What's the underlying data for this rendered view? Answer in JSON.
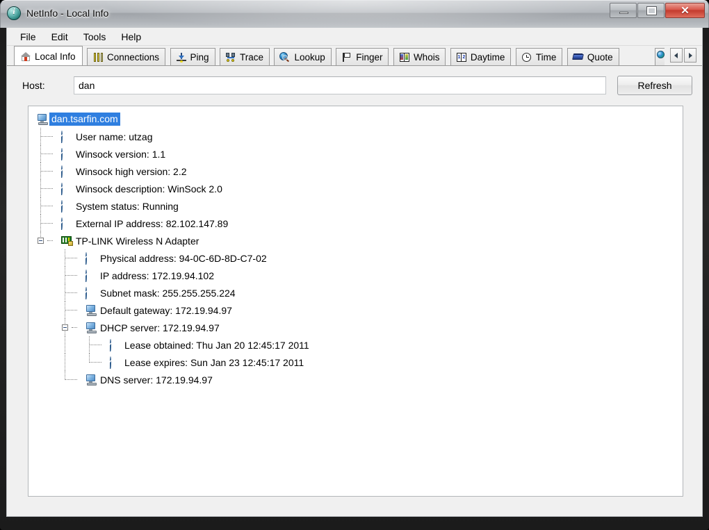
{
  "window": {
    "title": "NetInfo - Local Info",
    "app_icon": "info-circle-icon",
    "minimize_label": "Minimize",
    "maximize_label": "Maximize",
    "close_label": "✕"
  },
  "menubar": {
    "items": [
      {
        "label": "File"
      },
      {
        "label": "Edit"
      },
      {
        "label": "Tools"
      },
      {
        "label": "Help"
      }
    ]
  },
  "tabs": {
    "items": [
      {
        "label": "Local Info",
        "icon": "home-icon",
        "active": true
      },
      {
        "label": "Connections",
        "icon": "connections-icon",
        "active": false
      },
      {
        "label": "Ping",
        "icon": "ping-icon",
        "active": false
      },
      {
        "label": "Trace",
        "icon": "trace-icon",
        "active": false
      },
      {
        "label": "Lookup",
        "icon": "lookup-globe-icon",
        "active": false
      },
      {
        "label": "Finger",
        "icon": "finger-flag-icon",
        "active": false
      },
      {
        "label": "Whois",
        "icon": "whois-book-icon",
        "active": false
      },
      {
        "label": "Daytime",
        "icon": "daytime-book-icon",
        "active": false
      },
      {
        "label": "Time",
        "icon": "clock-icon",
        "active": false
      },
      {
        "label": "Quote",
        "icon": "quote-book-icon",
        "active": false
      }
    ],
    "scroll_left_icon": "arrow-left-icon",
    "scroll_right_icon": "arrow-right-icon",
    "partial_tab_icon": "globe-icon"
  },
  "host": {
    "label": "Host:",
    "value": "dan",
    "placeholder": "",
    "refresh_label": "Refresh"
  },
  "tree": {
    "root": {
      "label": "dan.tsarfin.com",
      "icon": "computer-icon",
      "selected": true
    },
    "root_children": [
      {
        "label": "User name: utzag",
        "icon": "info-icon"
      },
      {
        "label": "Winsock version: 1.1",
        "icon": "info-icon"
      },
      {
        "label": "Winsock high version: 2.2",
        "icon": "info-icon"
      },
      {
        "label": "Winsock description: WinSock 2.0",
        "icon": "info-icon"
      },
      {
        "label": "System status: Running",
        "icon": "info-icon"
      },
      {
        "label": "External IP address: 82.102.147.89",
        "icon": "info-icon"
      }
    ],
    "adapter": {
      "label": "TP-LINK Wireless N Adapter",
      "icon": "network-card-icon",
      "expanded": true
    },
    "adapter_children": [
      {
        "label": "Physical address: 94-0C-6D-8D-C7-02",
        "icon": "info-icon",
        "expandable": false
      },
      {
        "label": "IP address: 172.19.94.102",
        "icon": "info-icon",
        "expandable": false
      },
      {
        "label": "Subnet mask: 255.255.255.224",
        "icon": "info-icon",
        "expandable": false
      },
      {
        "label": "Default gateway: 172.19.94.97",
        "icon": "computer-icon",
        "expandable": false
      },
      {
        "label": "DHCP server: 172.19.94.97",
        "icon": "computer-icon",
        "expandable": true
      }
    ],
    "dhcp_children": [
      {
        "label": "Lease obtained: Thu Jan 20 12:45:17 2011",
        "icon": "info-icon"
      },
      {
        "label": "Lease expires: Sun Jan 23 12:45:17 2011",
        "icon": "info-icon"
      }
    ],
    "dns": {
      "label": "DNS server: 172.19.94.97",
      "icon": "computer-icon"
    }
  },
  "colors": {
    "selection": "#2f7fe0",
    "window_bg": "#f0f0f0",
    "tree_bg": "#ffffff",
    "close_button": "#c33a2d",
    "frame": "#1a1a1a"
  }
}
